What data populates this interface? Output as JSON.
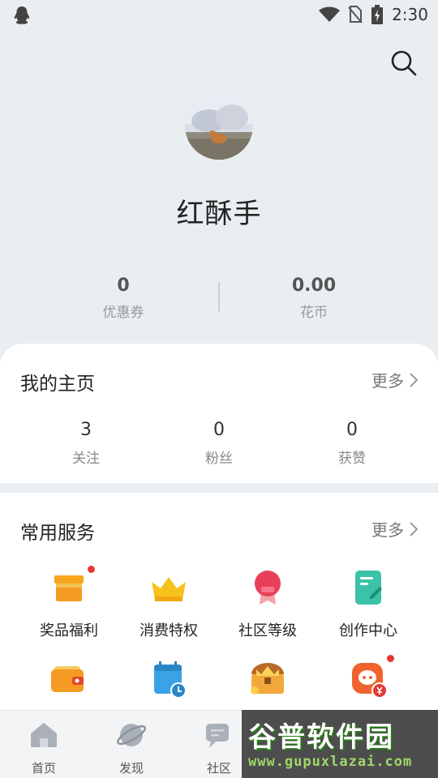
{
  "status_bar": {
    "time": "2:30",
    "icons": [
      "qq-icon",
      "wifi-icon",
      "no-sim-icon",
      "battery-charging-icon"
    ]
  },
  "header": {
    "search_icon": "search-icon"
  },
  "profile": {
    "username": "红酥手"
  },
  "stats": [
    {
      "value": "0",
      "label": "优惠券"
    },
    {
      "value": "0.00",
      "label": "花币"
    }
  ],
  "my_home": {
    "title": "我的主页",
    "more_label": "更多",
    "counts": [
      {
        "value": "3",
        "label": "关注"
      },
      {
        "value": "0",
        "label": "粉丝"
      },
      {
        "value": "0",
        "label": "获赞"
      }
    ]
  },
  "services": {
    "title": "常用服务",
    "more_label": "更多",
    "items": [
      {
        "label": "奖品福利",
        "icon": "gift-icon",
        "badge": true
      },
      {
        "label": "消费特权",
        "icon": "crown-icon",
        "badge": false
      },
      {
        "label": "社区等级",
        "icon": "medal-icon",
        "badge": false
      },
      {
        "label": "创作中心",
        "icon": "note-edit-icon",
        "badge": false
      },
      {
        "label": "",
        "icon": "wallet-icon",
        "badge": false
      },
      {
        "label": "",
        "icon": "calendar-clock-icon",
        "badge": false
      },
      {
        "label": "",
        "icon": "treasure-chest-icon",
        "badge": false
      },
      {
        "label": "",
        "icon": "coin-service-icon",
        "badge": true
      }
    ]
  },
  "bottom_nav": [
    {
      "label": "首页",
      "icon": "home-icon"
    },
    {
      "label": "发现",
      "icon": "planet-icon"
    },
    {
      "label": "社区",
      "icon": "chat-icon"
    }
  ],
  "watermark": {
    "title": "谷普软件园",
    "url": "www.gupuxlazai.com"
  },
  "colors": {
    "page_bg": "#e9eef1",
    "card_bg": "#ffffff",
    "badge": "#e53935",
    "accent_orange": "#f59a23"
  }
}
